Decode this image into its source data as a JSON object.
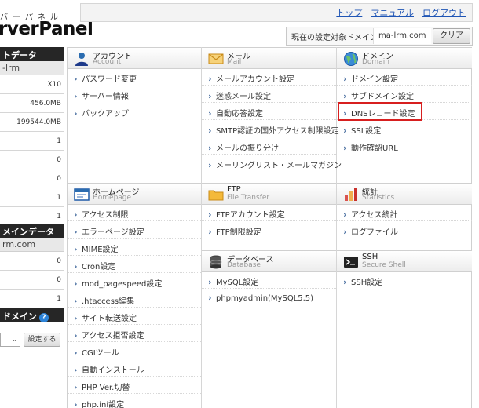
{
  "logo": {
    "sub": "バーパネル",
    "main": "rverPanel"
  },
  "topnav": {
    "links": [
      "トップ",
      "マニュアル",
      "ログアウト"
    ]
  },
  "domain_selector": {
    "label": "現在の設定対象ドメイン",
    "value": "ma-lrm.com",
    "clear_button": "クリア"
  },
  "sidebar": {
    "account_data": {
      "title": "トデータ",
      "name": "-lrm",
      "rows": [
        "X10",
        "456.0MB",
        "199544.0MB",
        "1",
        "0",
        "0",
        "1",
        "1"
      ]
    },
    "main_domain_data": {
      "title": "メインデータ",
      "name": "rm.com",
      "rows": [
        "0",
        "0",
        "1"
      ]
    },
    "domain_section": {
      "title": "ドメイン",
      "submit_button": "設定する"
    }
  },
  "sections": {
    "account": {
      "title": "アカウント",
      "subtitle": "Account",
      "items": [
        "パスワード変更",
        "サーバー情報",
        "バックアップ"
      ]
    },
    "mail": {
      "title": "メール",
      "subtitle": "Mail",
      "items": [
        "メールアカウント設定",
        "迷惑メール設定",
        "自動応答設定",
        "SMTP認証の国外アクセス制限設定",
        "メールの振り分け",
        "メーリングリスト・メールマガジン"
      ]
    },
    "domain": {
      "title": "ドメイン",
      "subtitle": "Domain",
      "items": [
        "ドメイン設定",
        "サブドメイン設定",
        "DNSレコード設定",
        "SSL設定",
        "動作確認URL"
      ]
    },
    "homepage": {
      "title": "ホームページ",
      "subtitle": "Homepage",
      "items": [
        "アクセス制限",
        "エラーページ設定",
        "MIME設定",
        "Cron設定",
        "mod_pagespeed設定",
        ".htaccess編集",
        "サイト転送設定",
        "アクセス拒否設定",
        "CGIツール",
        "自動インストール",
        "PHP Ver.切替",
        "php.ini設定"
      ]
    },
    "ftp": {
      "title": "FTP",
      "subtitle": "File Transfer",
      "items": [
        "FTPアカウント設定",
        "FTP制限設定"
      ]
    },
    "stats": {
      "title": "統計",
      "subtitle": "Statistics",
      "items": [
        "アクセス統計",
        "ログファイル"
      ]
    },
    "database": {
      "title": "データベース",
      "subtitle": "Database",
      "items": [
        "MySQL設定",
        "phpmyadmin(MySQL5.5)"
      ]
    },
    "ssh": {
      "title": "SSH",
      "subtitle": "Secure Shell",
      "items": [
        "SSH設定"
      ]
    }
  }
}
